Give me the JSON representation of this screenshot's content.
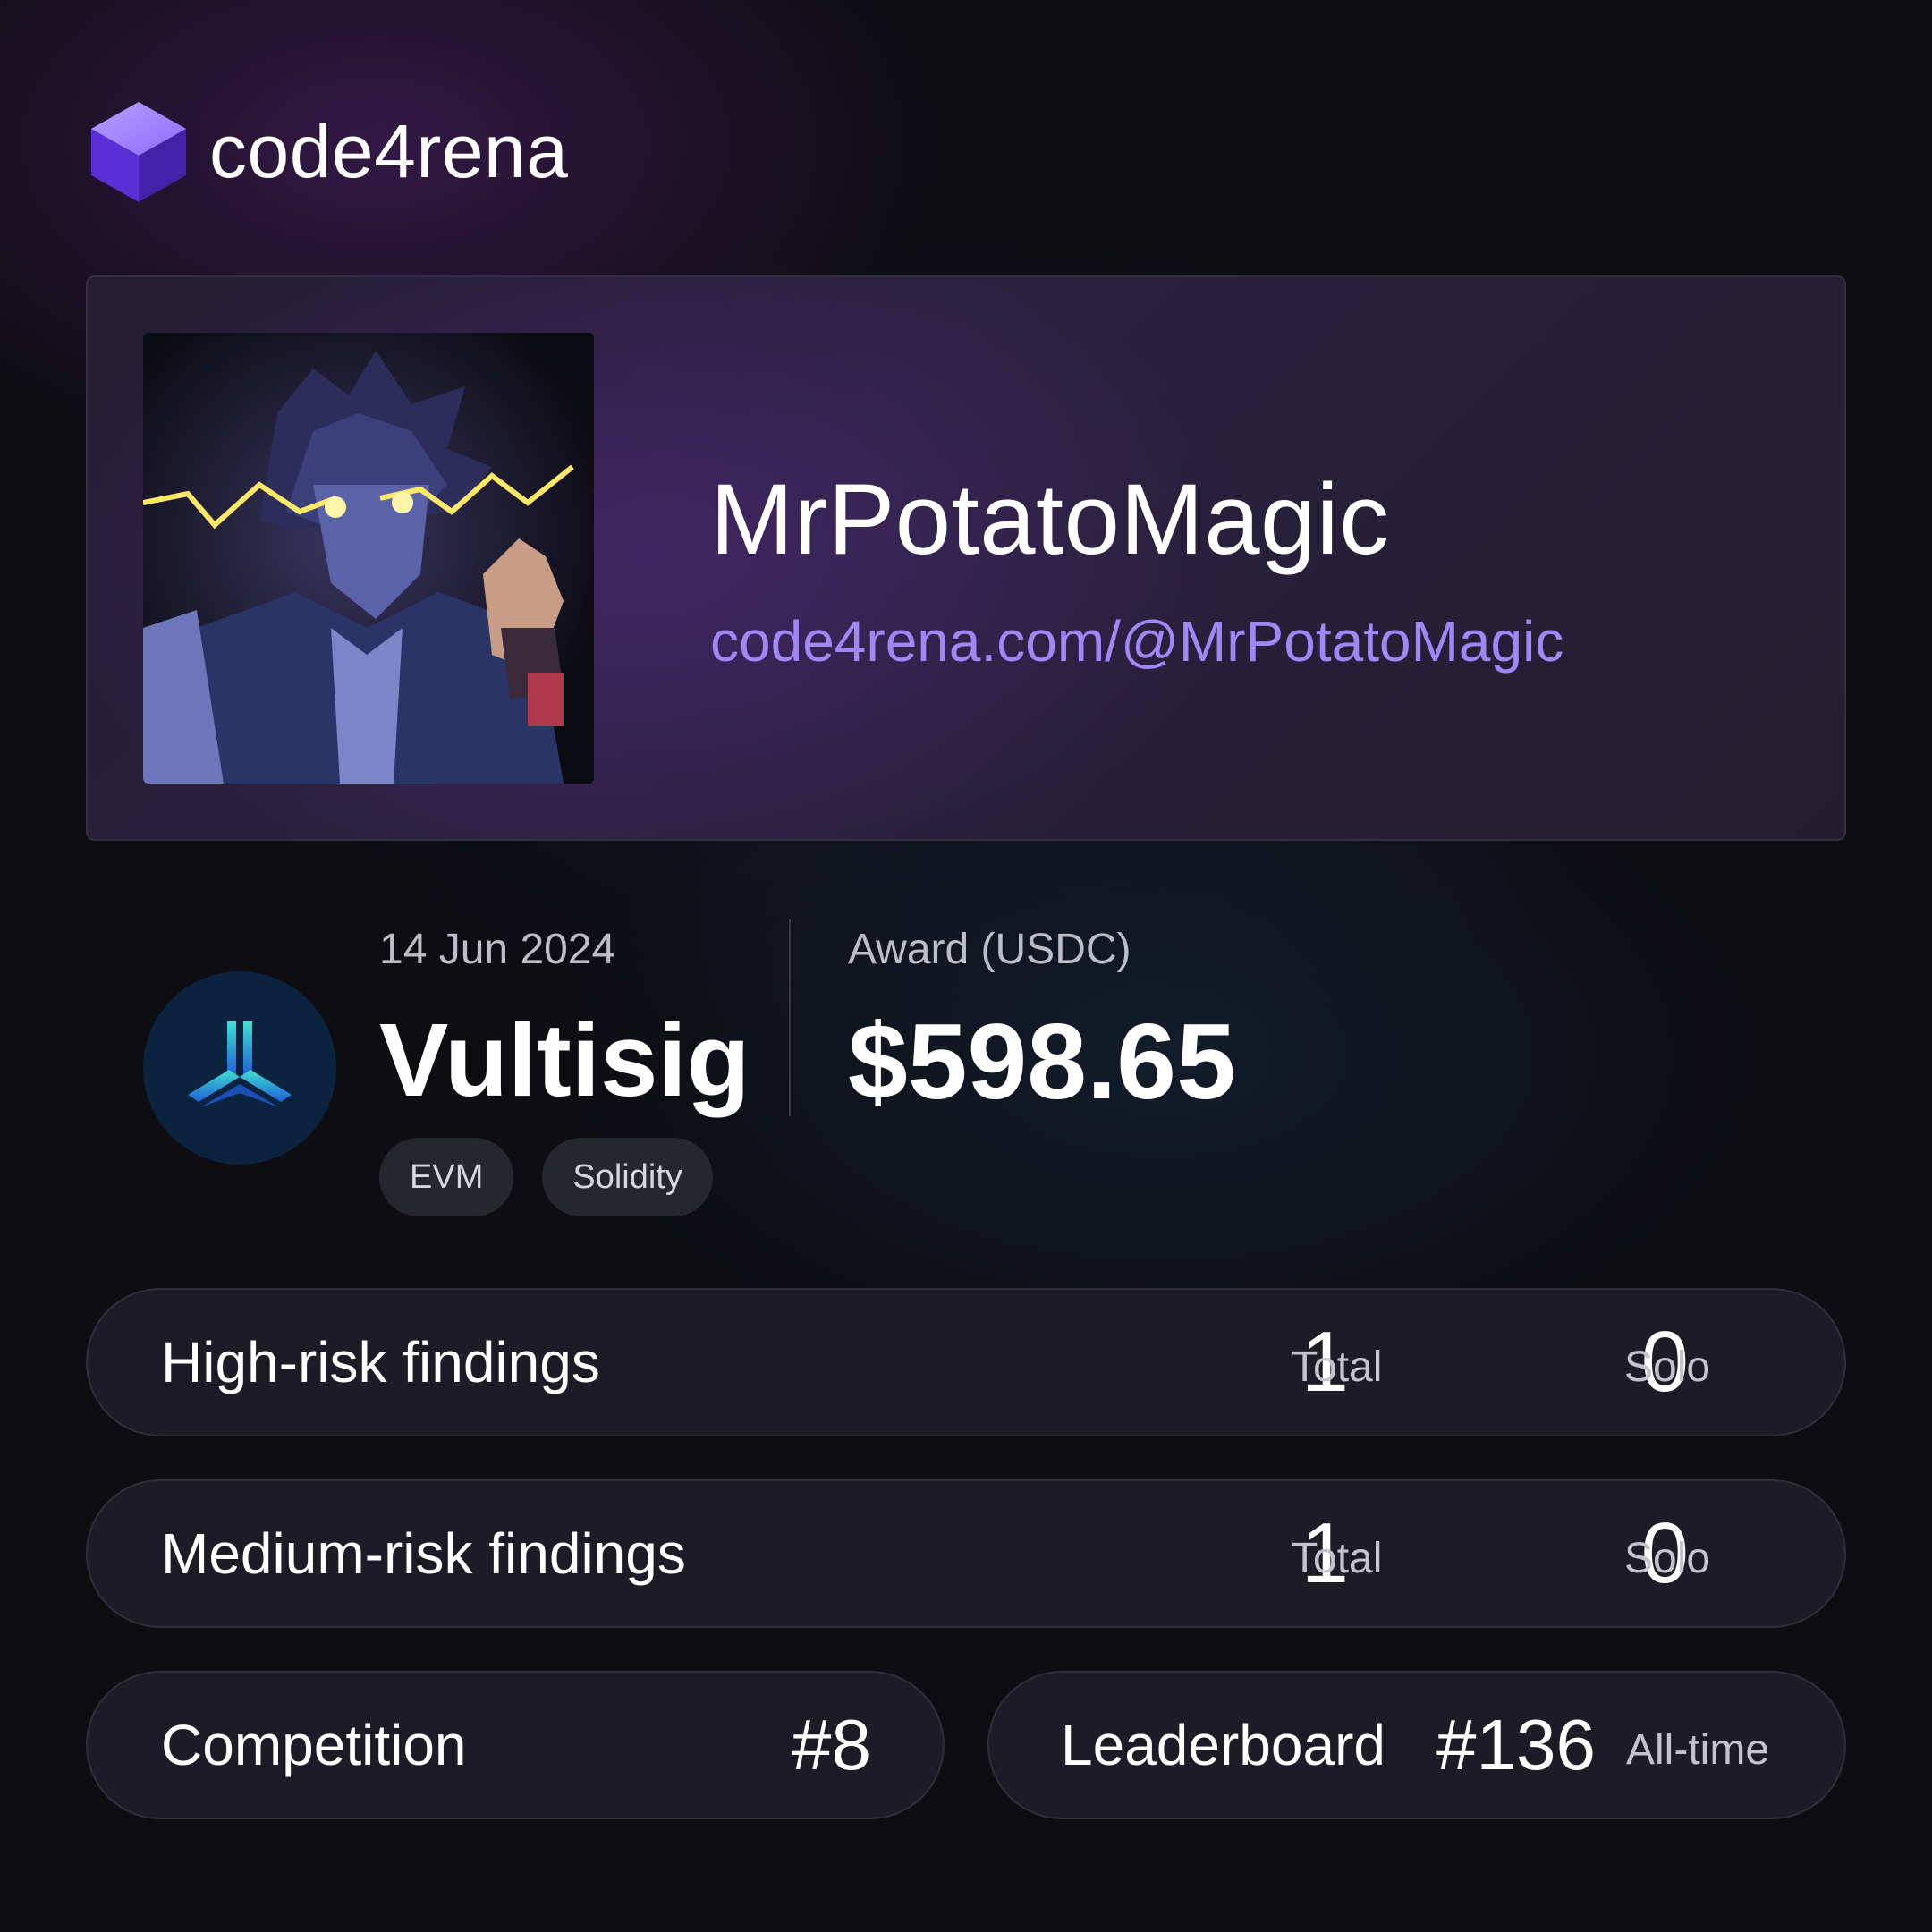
{
  "brand": {
    "name": "code4rena",
    "icon": "cube-logo-icon",
    "accent_color": "#6a3cf0"
  },
  "profile": {
    "username": "MrPotatoMagic",
    "profile_url": "code4rena.com/@MrPotatoMagic",
    "avatar": "anime-character-avatar",
    "link_color": "#9f87f5"
  },
  "contest": {
    "date": "14 Jun 2024",
    "name": "Vultisig",
    "logo": "vultisig-logo-icon",
    "tags": [
      "EVM",
      "Solidity"
    ]
  },
  "award": {
    "label": "Award (USDC)",
    "value": "$598.65"
  },
  "findings": [
    {
      "label": "High-risk findings",
      "total": "1",
      "total_label": "Total",
      "solo": "0",
      "solo_label": "Solo"
    },
    {
      "label": "Medium-risk findings",
      "total": "1",
      "total_label": "Total",
      "solo": "0",
      "solo_label": "Solo"
    }
  ],
  "competition": {
    "label": "Competition",
    "rank": "#8"
  },
  "leaderboard": {
    "label": "Leaderboard",
    "rank": "#136",
    "scope": "All-time"
  }
}
